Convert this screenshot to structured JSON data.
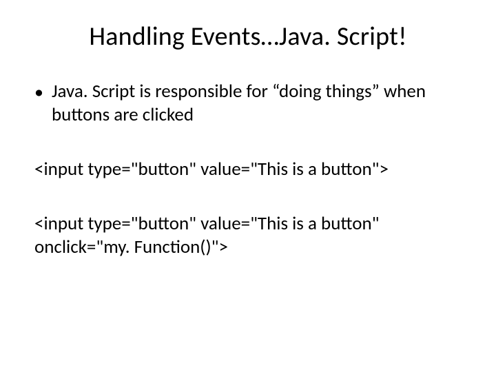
{
  "title": "Handling Events…Java. Script!",
  "bullet": {
    "dot": "•",
    "text": "Java. Script is responsible for “doing things” when buttons are clicked"
  },
  "code1": "<input type=\"button\" value=\"This is a button\">",
  "code2": "<input type=\"button\" value=\"This is a button\" onclick=\"my. Function()\">"
}
